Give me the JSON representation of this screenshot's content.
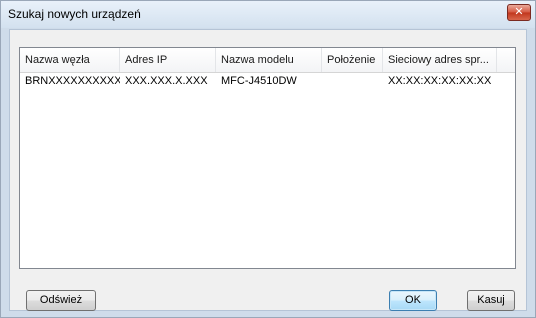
{
  "window": {
    "title": "Szukaj nowych urządzeń",
    "close_label": "✕"
  },
  "table": {
    "headers": [
      "Nazwa węzła",
      "Adres IP",
      "Nazwa modelu",
      "Położenie",
      "Sieciowy adres spr..."
    ],
    "rows": [
      [
        "BRNXXXXXXXXXXXX",
        "XXX.XXX.X.XXX",
        "MFC-J4510DW",
        "",
        "XX:XX:XX:XX:XX:XX"
      ]
    ]
  },
  "buttons": {
    "refresh": "Odśwież",
    "ok": "OK",
    "cancel": "Kasuj"
  },
  "colors": {
    "title_bar": "#d3e1ef",
    "close_button": "#c0351c",
    "dialog_face": "#f0f0f0",
    "default_button_border": "#3c7fb1"
  }
}
